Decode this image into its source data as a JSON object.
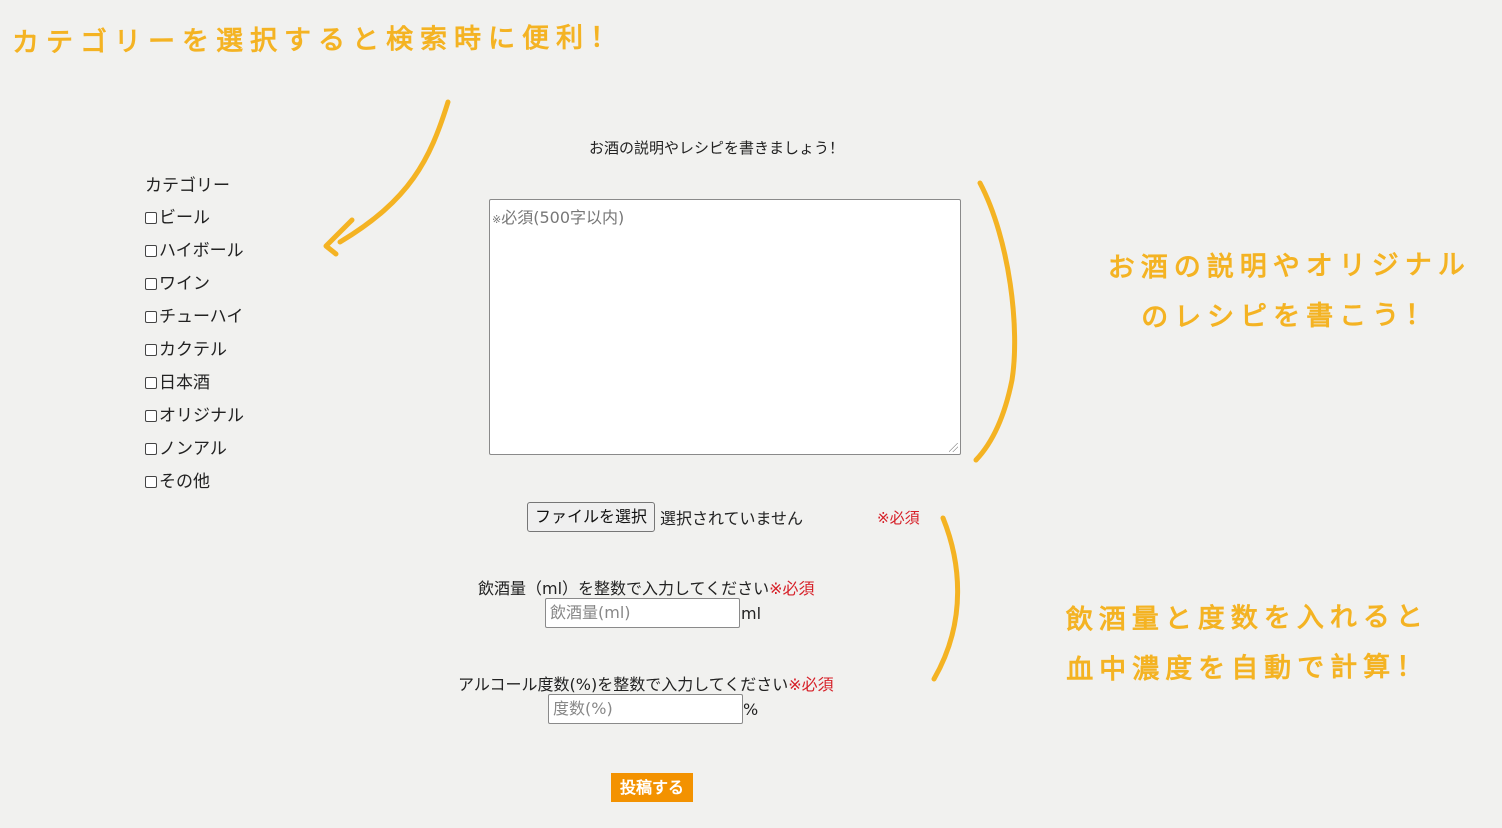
{
  "annotations": {
    "category_tip": "カテゴリーを選択すると検索時に便利！",
    "description_tip_line1": "お酒の説明やオリジナル",
    "description_tip_line2": "のレシピを書こう！",
    "amount_tip_line1": "飲酒量と度数を入れると",
    "amount_tip_line2": "血中濃度を自動で計算！"
  },
  "form": {
    "heading": "お酒の説明やレシピを書きましょう！",
    "category": {
      "title": "カテゴリー",
      "options": [
        "ビール",
        "ハイボール",
        "ワイン",
        "チューハイ",
        "カクテル",
        "日本酒",
        "オリジナル",
        "ノンアル",
        "その他"
      ]
    },
    "description": {
      "required_mark": "※",
      "placeholder": "必須(500字以内)"
    },
    "file": {
      "button_label": "ファイルを選択",
      "status": "選択されていません",
      "required": "※必須"
    },
    "amount": {
      "label": "飲酒量（ml）を整数で入力してください",
      "required": "※必須",
      "placeholder": "飲酒量(ml)",
      "unit": "ml"
    },
    "alcohol": {
      "label": "アルコール度数(%)を整数で入力してください",
      "required": "※必須",
      "placeholder": "度数(%)",
      "unit": "%"
    },
    "submit_label": "投稿する"
  },
  "colors": {
    "annotation": "#f4b323",
    "required": "#d62028",
    "submit_bg": "#f39200",
    "background": "#f1f1ef"
  }
}
